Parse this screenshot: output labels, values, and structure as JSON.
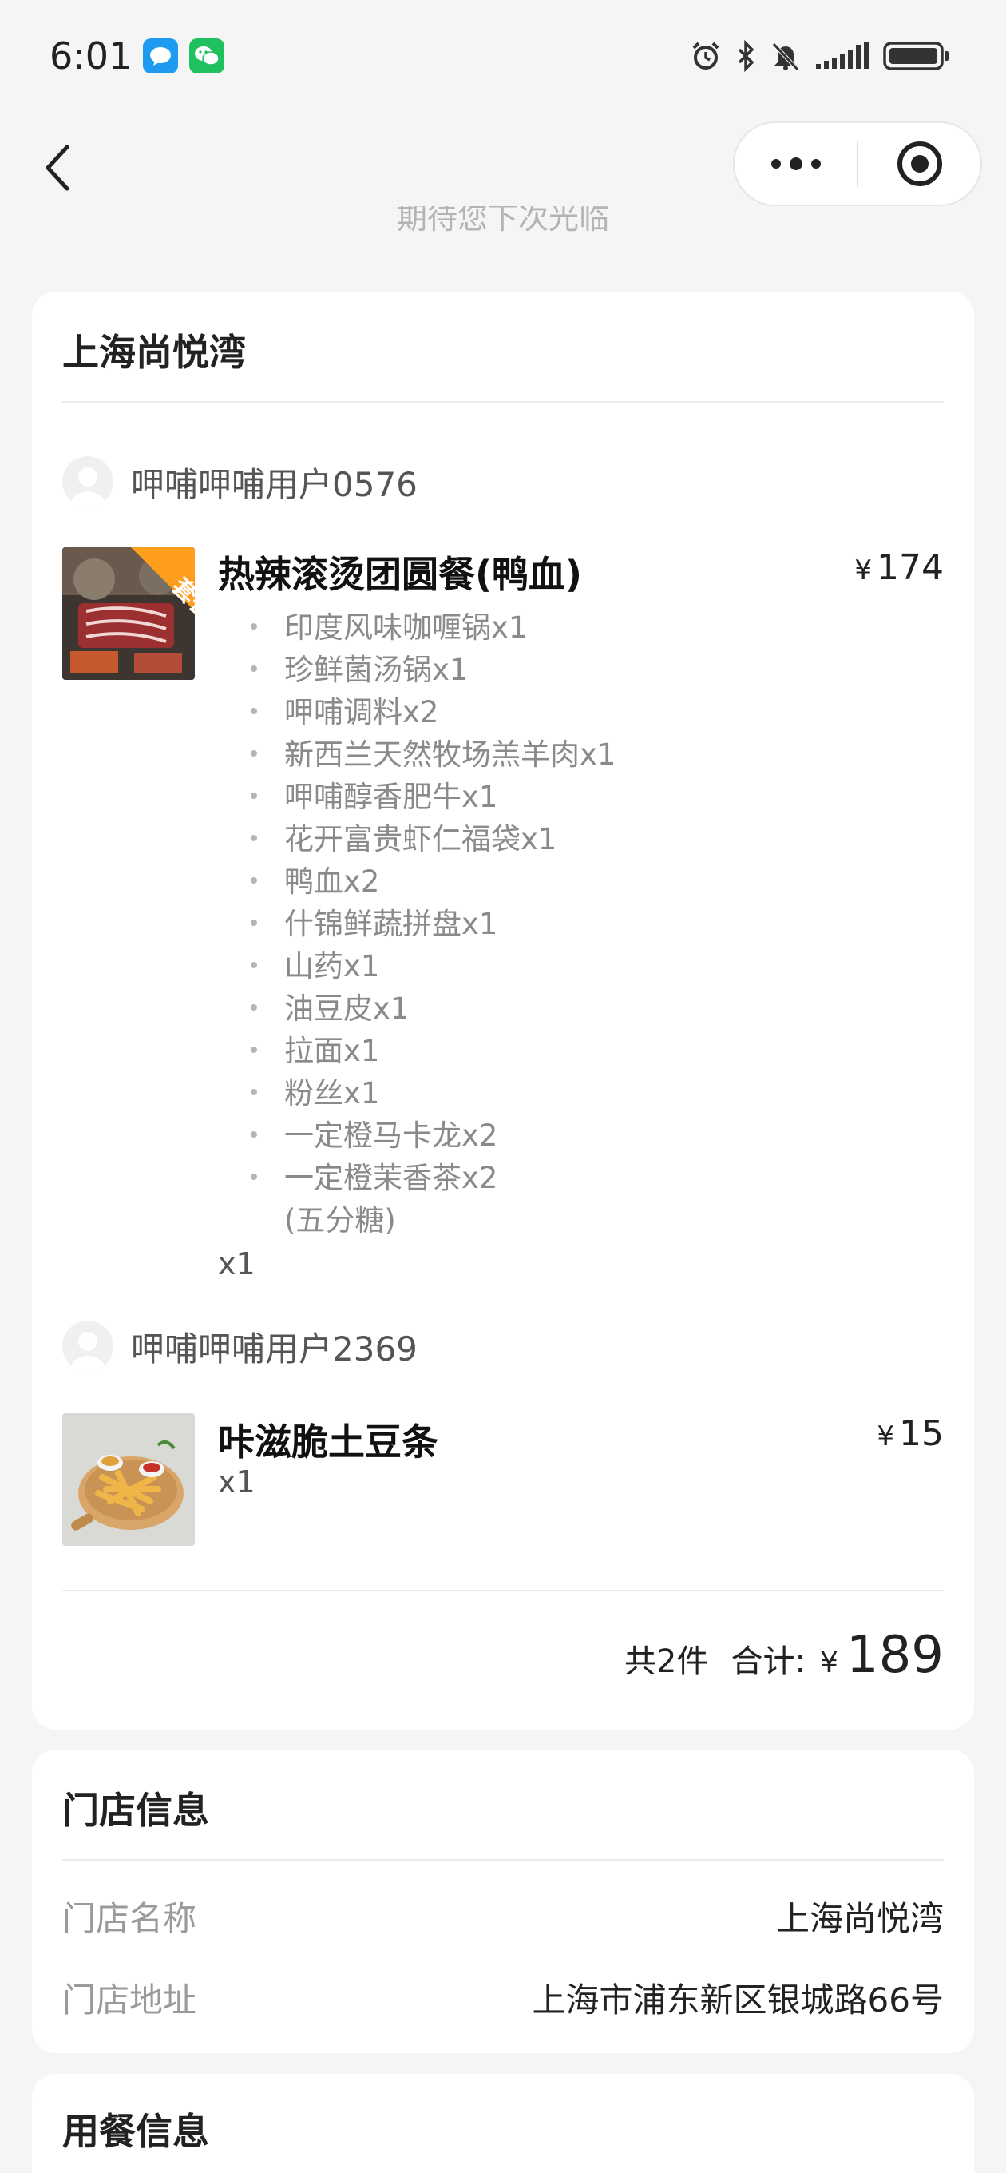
{
  "status_bar": {
    "time": "6:01",
    "app_icons": [
      "message-app-icon",
      "wechat-icon"
    ],
    "indicators": [
      "alarm-icon",
      "bluetooth-icon",
      "mute-icon",
      "signal-icon",
      "battery-icon"
    ]
  },
  "nav": {
    "back_icon": "chevron-left-icon",
    "capsule": [
      "more-icon",
      "record-icon"
    ]
  },
  "faded_header": "期待您下次光临",
  "order_card": {
    "store_name": "上海尚悦湾",
    "groups": [
      {
        "user": "呷哺呷哺用户0576",
        "item": {
          "name": "热辣滚烫团圆餐(鸭血)",
          "price": "174",
          "badge": "套餐",
          "qty": "x1",
          "sub_items": [
            "印度风味咖喱锅x1",
            "珍鲜菌汤锅x1",
            "呷哺调料x2",
            "新西兰天然牧场羔羊肉x1",
            "呷哺醇香肥牛x1",
            "花开富贵虾仁福袋x1",
            "鸭血x2",
            "什锦鲜蔬拼盘x1",
            "山药x1",
            "油豆皮x1",
            "拉面x1",
            "粉丝x1",
            "一定橙马卡龙x2",
            "一定橙茉香茶x2"
          ],
          "sub_note": "(五分糖)"
        }
      },
      {
        "user": "呷哺呷哺用户2369",
        "item": {
          "name": "咔滋脆土豆条",
          "price": "15",
          "qty": "x1"
        }
      }
    ],
    "currency": "¥",
    "summary": {
      "count_text": "共2件",
      "total_label": "合计:",
      "total": "189"
    }
  },
  "store_card": {
    "title": "门店信息",
    "rows": [
      {
        "label": "门店名称",
        "value": "上海尚悦湾"
      },
      {
        "label": "门店地址",
        "value": "上海市浦东新区银城路66号"
      }
    ]
  },
  "dining_card": {
    "title": "用餐信息"
  }
}
